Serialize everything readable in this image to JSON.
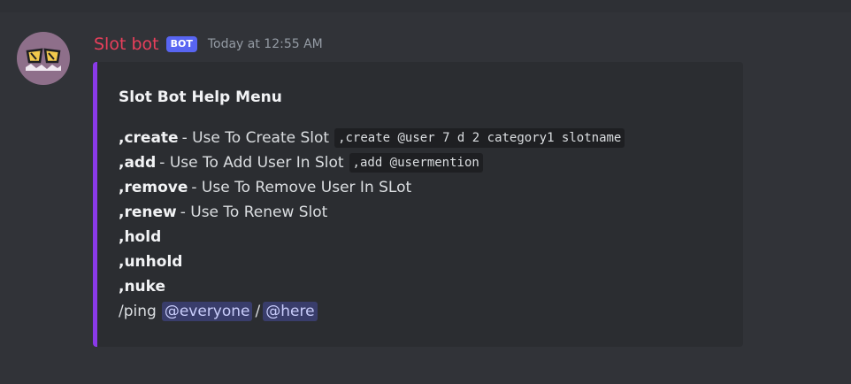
{
  "message": {
    "username": "Slot bot",
    "badge": "BOT",
    "timestamp": "Today at 12:55 AM"
  },
  "embed": {
    "title": "Slot Bot Help Menu",
    "accent_color": "#8a3ae8",
    "lines": [
      {
        "command": ",create",
        "description": "- Use To Create Slot",
        "code": ",create @user 7 d 2 category1 slotname"
      },
      {
        "command": ",add",
        "description": "- Use To Add User In Slot",
        "code": ",add @usermention"
      },
      {
        "command": ",remove",
        "description": "- Use To Remove User In SLot"
      },
      {
        "command": ",renew",
        "description": "- Use To Renew Slot"
      },
      {
        "command": ",hold"
      },
      {
        "command": ",unhold"
      },
      {
        "command": ",nuke"
      }
    ],
    "ping": {
      "prefix": "/ping",
      "mention1": "@everyone",
      "separator": "/",
      "mention2": "@here"
    }
  },
  "colors": {
    "background": "#313338",
    "username": "#e83f5b",
    "badge": "#5865f2",
    "embed_background": "#2b2d31"
  },
  "icons": {
    "avatar": "bot-avatar-sunglasses"
  }
}
